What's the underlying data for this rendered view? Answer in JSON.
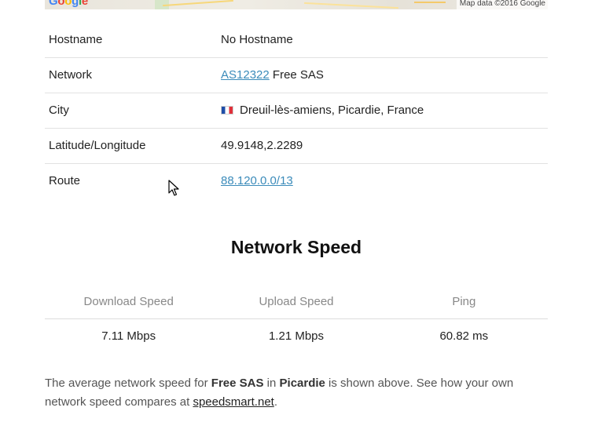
{
  "map": {
    "logo_text": "Google",
    "attribution": "Map data ©2016 Google"
  },
  "info": {
    "rows": [
      {
        "label": "Hostname",
        "value": "No Hostname"
      },
      {
        "label": "Network",
        "link": "AS12322",
        "value": "Free SAS"
      },
      {
        "label": "City",
        "flag_icon": "france-flag-icon",
        "value": "Dreuil-lès-amiens, Picardie, France"
      },
      {
        "label": "Latitude/Longitude",
        "value": "49.9148,2.2289"
      },
      {
        "label": "Route",
        "link": "88.120.0.0/13"
      }
    ]
  },
  "speed": {
    "title": "Network Speed",
    "headers": [
      "Download Speed",
      "Upload Speed",
      "Ping"
    ],
    "values": [
      "7.11 Mbps",
      "1.21 Mbps",
      "60.82 ms"
    ]
  },
  "summary": {
    "prefix": "The average network speed for ",
    "isp": "Free SAS",
    "mid1": " in ",
    "region": "Picardie",
    "mid2": " is shown above. See how your own network speed compares at ",
    "link": "speedsmart.net",
    "suffix": "."
  },
  "colors": {
    "link": "#3b8bba",
    "muted": "#888888",
    "divider": "#e2e2e2"
  }
}
